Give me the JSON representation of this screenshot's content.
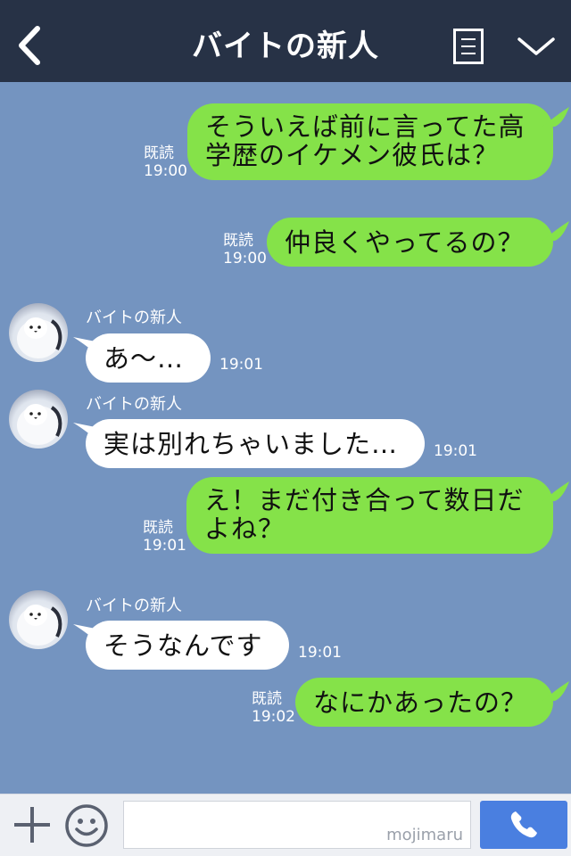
{
  "header": {
    "title": "バイトの新人",
    "back_icon": "chevron-left-icon",
    "menu_icon": "notes-icon",
    "collapse_icon": "chevron-down-icon"
  },
  "colors": {
    "header_bg": "#273246",
    "chat_bg": "#7494c0",
    "outgoing_bubble": "#85e249",
    "incoming_bubble": "#ffffff",
    "send_button": "#4a7fe0"
  },
  "messages": [
    {
      "direction": "out",
      "lines": [
        "そういえば前に言ってた高",
        "学歴のイケメン彼氏は？"
      ],
      "read": "既読",
      "time": "19:00"
    },
    {
      "direction": "out",
      "text": "仲良くやってるの？",
      "read": "既読",
      "time": "19:00"
    },
    {
      "direction": "in",
      "sender": "バイトの新人",
      "text": "あ〜…",
      "time": "19:01"
    },
    {
      "direction": "in",
      "sender": "バイトの新人",
      "text": "実は別れちゃいました…",
      "time": "19:01"
    },
    {
      "direction": "out",
      "lines": [
        "え！まだ付き合って数日だ",
        "よね？"
      ],
      "read": "既読",
      "time": "19:01"
    },
    {
      "direction": "in",
      "sender": "バイトの新人",
      "text": "そうなんです",
      "time": "19:01"
    },
    {
      "direction": "out",
      "text": "なにかあったの？",
      "read": "既読",
      "time": "19:02"
    }
  ],
  "inputbar": {
    "plus_icon": "plus-icon",
    "sticker_icon": "smiley-icon",
    "watermark": "mojimaru",
    "call_icon": "phone-icon"
  }
}
